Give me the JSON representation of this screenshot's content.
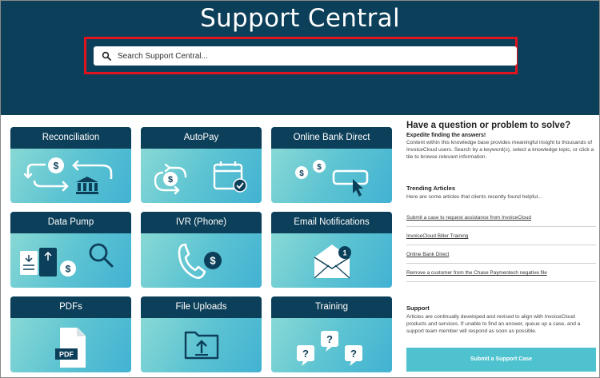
{
  "header": {
    "title": "Support Central",
    "bg_color": "#0c3f59"
  },
  "search": {
    "placeholder": "Search Support Central...",
    "highlight_color": "#e0141f"
  },
  "tiles": [
    {
      "label": "Reconciliation"
    },
    {
      "label": "AutoPay"
    },
    {
      "label": "Online Bank Direct"
    },
    {
      "label": "Data Pump"
    },
    {
      "label": "IVR (Phone)"
    },
    {
      "label": "Email Notifications"
    },
    {
      "label": "PDFs"
    },
    {
      "label": "File Uploads"
    },
    {
      "label": "Training"
    }
  ],
  "tile_art": {
    "pdf": "PDF",
    "badge": "1",
    "dollar": "$",
    "question": "?"
  },
  "panel": {
    "question_title": "Have a question or problem to solve?",
    "question_sub": "Expedite finding the answers!",
    "question_body": "Content within this knowledge base provides meaningful insight to thousands of InvoiceCloud users.  Search by a keyword(s), select a knowledge topic, or click a tile to browse relevant information.",
    "trending_title": "Trending Articles",
    "trending_body": "Here are some articles that clients recently found helpful...",
    "articles": [
      "Submit a case to request assistance from InvoiceCloud",
      "InvoiceCloud Biller Training",
      "Online Bank Direct",
      "Remove a customer from the Chase Paymentech negative file"
    ],
    "support_title": "Support",
    "support_body": "Articles are continually developed and revised to align with InvoiceCloud products and services.  If unable to find an answer, queue up a case, and a support team member will respond as soon as possible.",
    "cta_label": "Submit a Support Case",
    "accent_color": "#4ec3cf"
  }
}
